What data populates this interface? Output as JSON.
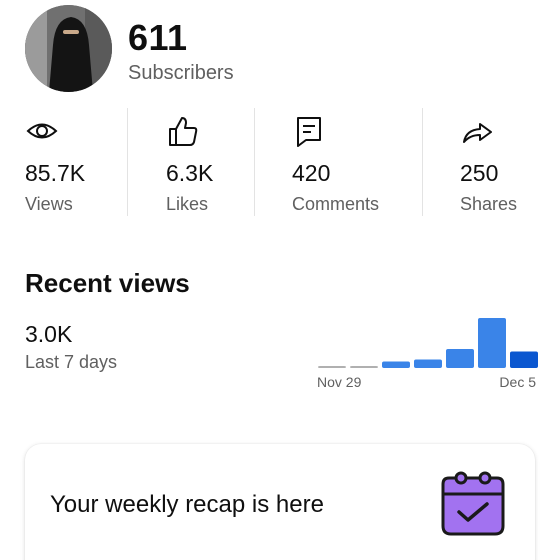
{
  "channel": {
    "subscriber_count": "611",
    "subscriber_label": "Subscribers"
  },
  "stats": [
    {
      "value": "85.7K",
      "label": "Views",
      "icon": "eye-icon"
    },
    {
      "value": "6.3K",
      "label": "Likes",
      "icon": "thumbs-up-icon"
    },
    {
      "value": "420",
      "label": "Comments",
      "icon": "comment-icon"
    },
    {
      "value": "250",
      "label": "Shares",
      "icon": "share-icon"
    }
  ],
  "recent_views": {
    "title": "Recent views",
    "value": "3.0K",
    "period": "Last 7 days"
  },
  "chart_data": {
    "type": "bar",
    "x_start_label": "Nov 29",
    "x_end_label": "Dec 5",
    "values": [
      0.02,
      0.02,
      0.13,
      0.17,
      0.38,
      1.0,
      0.33
    ],
    "highlight_index": 6,
    "colors": {
      "baseline": "#b0b0b0",
      "bar": "#3a84e8",
      "highlight": "#0b57d0"
    }
  },
  "recap_card": {
    "text": "Your weekly recap is here",
    "icon": "calendar-check-icon"
  },
  "colors": {
    "text_primary": "#0f0f0f",
    "text_secondary": "#606060",
    "recap_icon_fill": "#a272f0"
  }
}
